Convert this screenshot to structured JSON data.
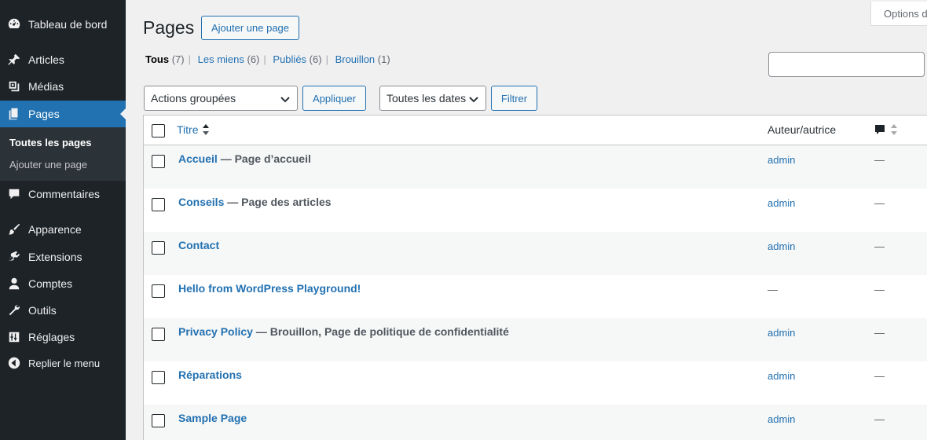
{
  "sidebar": {
    "items": [
      {
        "label": "Tableau de bord",
        "icon": "dashboard-icon"
      },
      {
        "label": "Articles",
        "icon": "pin-icon"
      },
      {
        "label": "Médias",
        "icon": "media-icon"
      },
      {
        "label": "Pages",
        "icon": "pages-icon"
      },
      {
        "label": "Commentaires",
        "icon": "comment-icon"
      },
      {
        "label": "Apparence",
        "icon": "brush-icon"
      },
      {
        "label": "Extensions",
        "icon": "plugin-icon"
      },
      {
        "label": "Comptes",
        "icon": "user-icon"
      },
      {
        "label": "Outils",
        "icon": "wrench-icon"
      },
      {
        "label": "Réglages",
        "icon": "settings-icon"
      }
    ],
    "submenu": [
      "Toutes les pages",
      "Ajouter une page"
    ],
    "collapse_label": "Replier le menu",
    "current_color": "#2271b1"
  },
  "header": {
    "title": "Pages",
    "add_new_label": "Ajouter une page",
    "screen_options_label": "Options de l’écran"
  },
  "filters": {
    "views": [
      {
        "label": "Tous",
        "count": "(7)"
      },
      {
        "label": "Les miens",
        "count": "(6)"
      },
      {
        "label": "Publiés",
        "count": "(6)"
      },
      {
        "label": "Brouillon",
        "count": "(1)"
      }
    ],
    "search_value": "",
    "bulk_actions": "Actions groupées",
    "apply_label": "Appliquer",
    "dates": "Toutes les dates",
    "filter_label": "Filtrer"
  },
  "table": {
    "columns": {
      "title": "Titre",
      "author": "Auteur/autrice"
    },
    "rows": [
      {
        "title": "Accueil",
        "state": " — Page d’accueil",
        "author": "admin",
        "comments": "—"
      },
      {
        "title": "Conseils",
        "state": " — Page des articles",
        "author": "admin",
        "comments": "—"
      },
      {
        "title": "Contact",
        "state": "",
        "author": "admin",
        "comments": "—"
      },
      {
        "title": "Hello from WordPress Playground!",
        "state": "",
        "author": "—",
        "comments": "—"
      },
      {
        "title": "Privacy Policy",
        "state": " — Brouillon, Page de politique de confidentialité",
        "author": "admin",
        "comments": "—"
      },
      {
        "title": "Réparations",
        "state": "",
        "author": "admin",
        "comments": "—"
      },
      {
        "title": "Sample Page",
        "state": "",
        "author": "admin",
        "comments": "—"
      }
    ]
  }
}
